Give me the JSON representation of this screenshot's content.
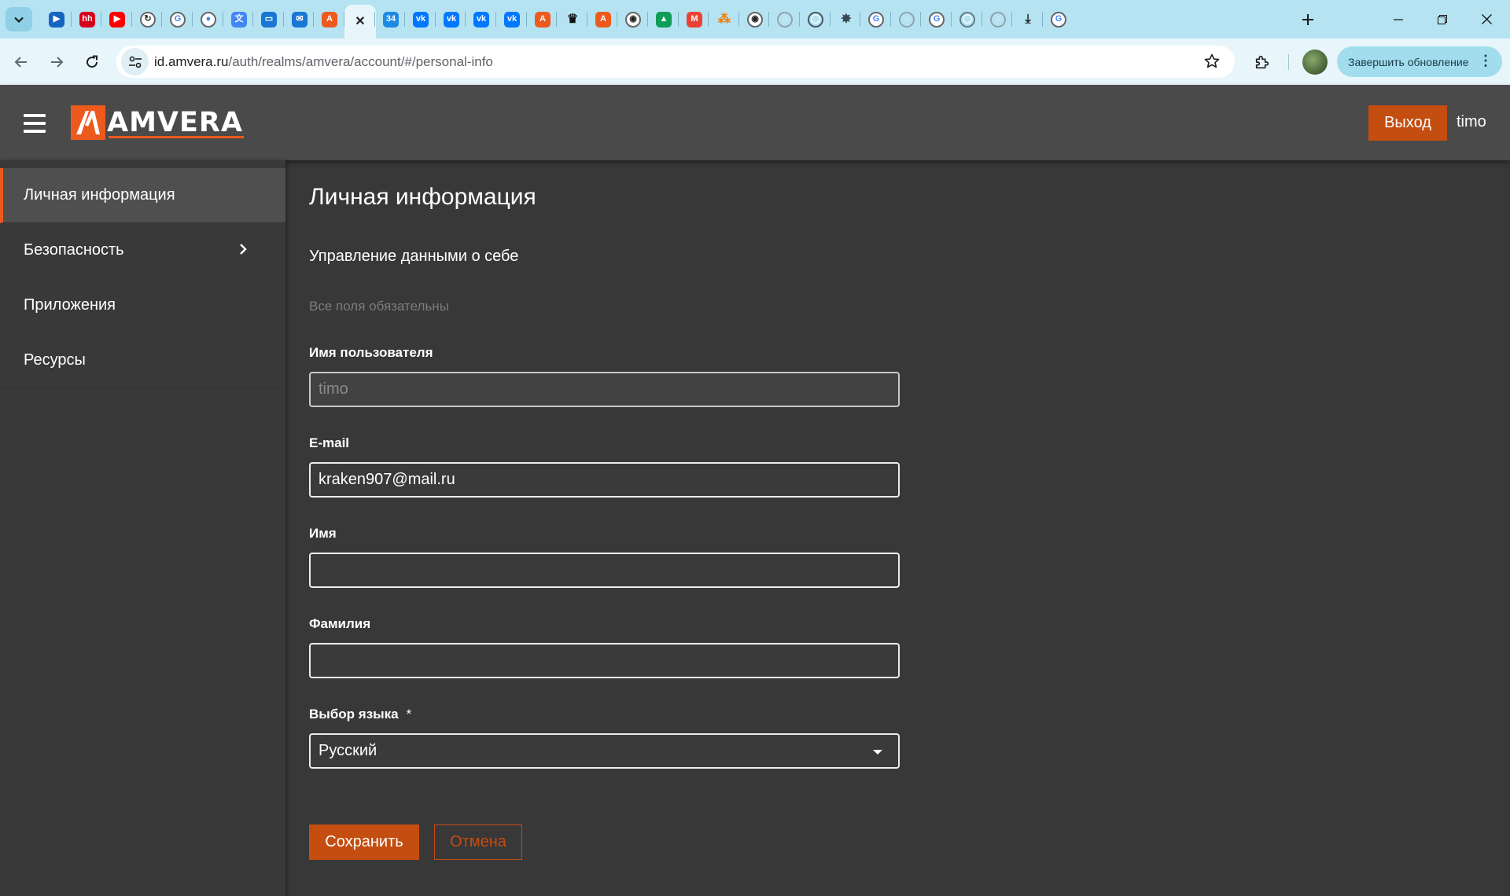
{
  "browser": {
    "tabs": [
      {
        "icon": "youtube-music-icon",
        "glyph": "▶",
        "color": "#1565c0"
      },
      {
        "icon": "hh-icon",
        "glyph": "hh",
        "color": "#d6001c"
      },
      {
        "icon": "youtube-icon",
        "glyph": "▶",
        "color": "#ff0000"
      },
      {
        "icon": "refresh-site-icon",
        "glyph": "↻",
        "color": "#222222"
      },
      {
        "icon": "google-icon",
        "glyph": "G",
        "color": "#4285f4"
      },
      {
        "icon": "google-password-icon",
        "glyph": "●",
        "color": "#4285f4"
      },
      {
        "icon": "google-translate-icon",
        "glyph": "文",
        "color": "#4285f4"
      },
      {
        "icon": "folder-icon",
        "glyph": "▭",
        "color": "#1976d2"
      },
      {
        "icon": "mail-icon",
        "glyph": "✉",
        "color": "#1976d2"
      },
      {
        "icon": "amvera-icon",
        "glyph": "A",
        "color": "#ec5a1e"
      },
      {
        "icon": "close-icon",
        "glyph": "✕",
        "color": "#222222"
      },
      {
        "icon": "badge-34-icon",
        "glyph": "34",
        "color": "#1e88e5"
      },
      {
        "icon": "vk-icon",
        "glyph": "vk",
        "color": "#0077ff"
      },
      {
        "icon": "vk-icon",
        "glyph": "vk",
        "color": "#0077ff"
      },
      {
        "icon": "vk-icon",
        "glyph": "vk",
        "color": "#0077ff"
      },
      {
        "icon": "vk-icon",
        "glyph": "vk",
        "color": "#0077ff"
      },
      {
        "icon": "amvera-icon",
        "glyph": "A",
        "color": "#ec5a1e"
      },
      {
        "icon": "crown-icon",
        "glyph": "♛",
        "color": "#111111"
      },
      {
        "icon": "amvera-icon",
        "glyph": "A",
        "color": "#ec5a1e"
      },
      {
        "icon": "github-icon",
        "glyph": "◉",
        "color": "#222222"
      },
      {
        "icon": "google-drive-icon",
        "glyph": "▲",
        "color": "#0f9d58"
      },
      {
        "icon": "gmail-icon",
        "glyph": "M",
        "color": "#ea4335"
      },
      {
        "icon": "app-icon",
        "glyph": "⁂",
        "color": "#f57c00"
      },
      {
        "icon": "github-icon",
        "glyph": "◉",
        "color": "#222222"
      },
      {
        "icon": "globe-icon",
        "glyph": "◌",
        "color": "#90a4ae"
      },
      {
        "icon": "site-icon",
        "glyph": "◯",
        "color": "#455a64"
      },
      {
        "icon": "extension-icon",
        "glyph": "✸",
        "color": "#37474f"
      },
      {
        "icon": "google-icon",
        "glyph": "G",
        "color": "#4285f4"
      },
      {
        "icon": "globe-icon",
        "glyph": "◌",
        "color": "#90a4ae"
      },
      {
        "icon": "google-icon",
        "glyph": "G",
        "color": "#4285f4"
      },
      {
        "icon": "site-icon",
        "glyph": "◯",
        "color": "#607d8b"
      },
      {
        "icon": "globe-icon",
        "glyph": "◌",
        "color": "#90a4ae"
      },
      {
        "icon": "download-icon",
        "glyph": "⤓",
        "color": "#222222"
      },
      {
        "icon": "google-icon",
        "glyph": "G",
        "color": "#4285f4"
      }
    ],
    "url_host": "id.amvera.ru",
    "url_path": "/auth/realms/amvera/account/#/personal-info",
    "update_label": "Завершить обновление"
  },
  "header": {
    "logo_text": "AMVERA",
    "logout_label": "Выход",
    "username": "timo"
  },
  "sidebar": {
    "items": [
      {
        "label": "Личная информация"
      },
      {
        "label": "Безопасность"
      },
      {
        "label": "Приложения"
      },
      {
        "label": "Ресурсы"
      }
    ]
  },
  "main": {
    "title": "Личная информация",
    "subtitle": "Управление данными о себе",
    "required_note": "Все поля обязательны",
    "fields": {
      "username": {
        "label": "Имя пользователя",
        "value": "timo"
      },
      "email": {
        "label": "E-mail",
        "value": "kraken907@mail.ru"
      },
      "first_name": {
        "label": "Имя",
        "value": ""
      },
      "last_name": {
        "label": "Фамилия",
        "value": ""
      },
      "language": {
        "label": "Выбор языка",
        "required_mark": "*",
        "value": "Русский"
      }
    },
    "save_label": "Сохранить",
    "cancel_label": "Отмена"
  },
  "colors": {
    "accent": "#c44d10",
    "brand_orange": "#ec5a1e",
    "background": "#383838",
    "header": "#4a4a4a"
  }
}
